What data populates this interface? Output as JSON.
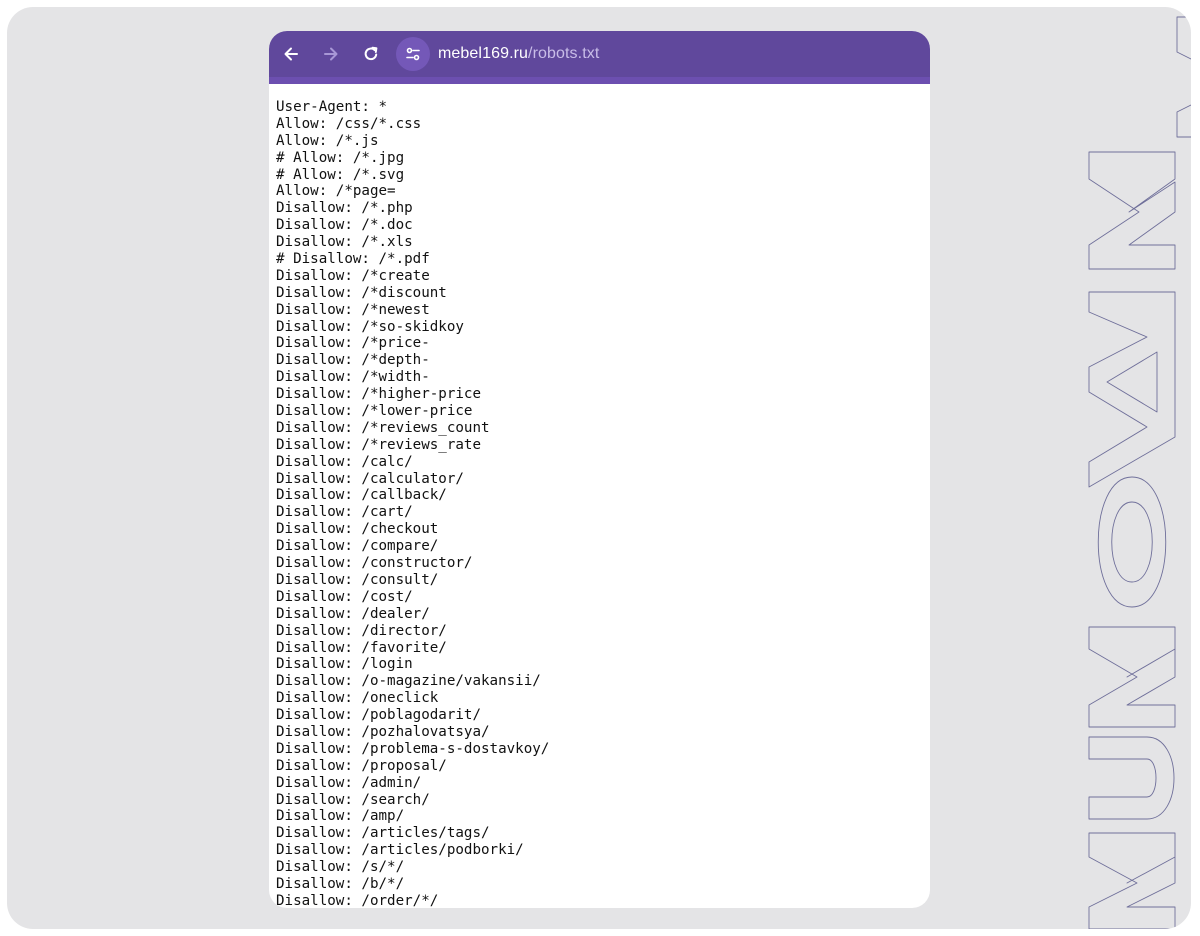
{
  "watermark": {
    "text": "KUKOYAKA",
    "stroke_color": "#6f6f9a"
  },
  "browser": {
    "toolbar_color": "#60489c",
    "nav": {
      "back_icon": "arrow-left-icon",
      "forward_icon": "arrow-right-icon",
      "reload_icon": "reload-icon",
      "site_info_icon": "tune-icon"
    },
    "url": {
      "domain": "mebel169.ru",
      "path": "/robots.txt"
    }
  },
  "document": {
    "lines": [
      "User-Agent: *",
      "Allow: /css/*.css",
      "Allow: /*.js",
      "# Allow: /*.jpg",
      "# Allow: /*.svg",
      "Allow: /*page=",
      "Disallow: /*.php",
      "Disallow: /*.doc",
      "Disallow: /*.xls",
      "# Disallow: /*.pdf",
      "Disallow: /*create",
      "Disallow: /*discount",
      "Disallow: /*newest",
      "Disallow: /*so-skidkoy",
      "Disallow: /*price-",
      "Disallow: /*depth-",
      "Disallow: /*width-",
      "Disallow: /*higher-price",
      "Disallow: /*lower-price",
      "Disallow: /*reviews_count",
      "Disallow: /*reviews_rate",
      "Disallow: /calc/",
      "Disallow: /calculator/",
      "Disallow: /callback/",
      "Disallow: /cart/",
      "Disallow: /checkout",
      "Disallow: /compare/",
      "Disallow: /constructor/",
      "Disallow: /consult/",
      "Disallow: /cost/",
      "Disallow: /dealer/",
      "Disallow: /director/",
      "Disallow: /favorite/",
      "Disallow: /login",
      "Disallow: /o-magazine/vakansii/",
      "Disallow: /oneclick",
      "Disallow: /poblagodarit/",
      "Disallow: /pozhalovatsya/",
      "Disallow: /problema-s-dostavkoy/",
      "Disallow: /proposal/",
      "Disallow: /admin/",
      "Disallow: /search/",
      "Disallow: /amp/",
      "Disallow: /articles/tags/",
      "Disallow: /articles/podborki/",
      "Disallow: /s/*/",
      "Disallow: /b/*/",
      "Disallow: /order/*/"
    ]
  }
}
